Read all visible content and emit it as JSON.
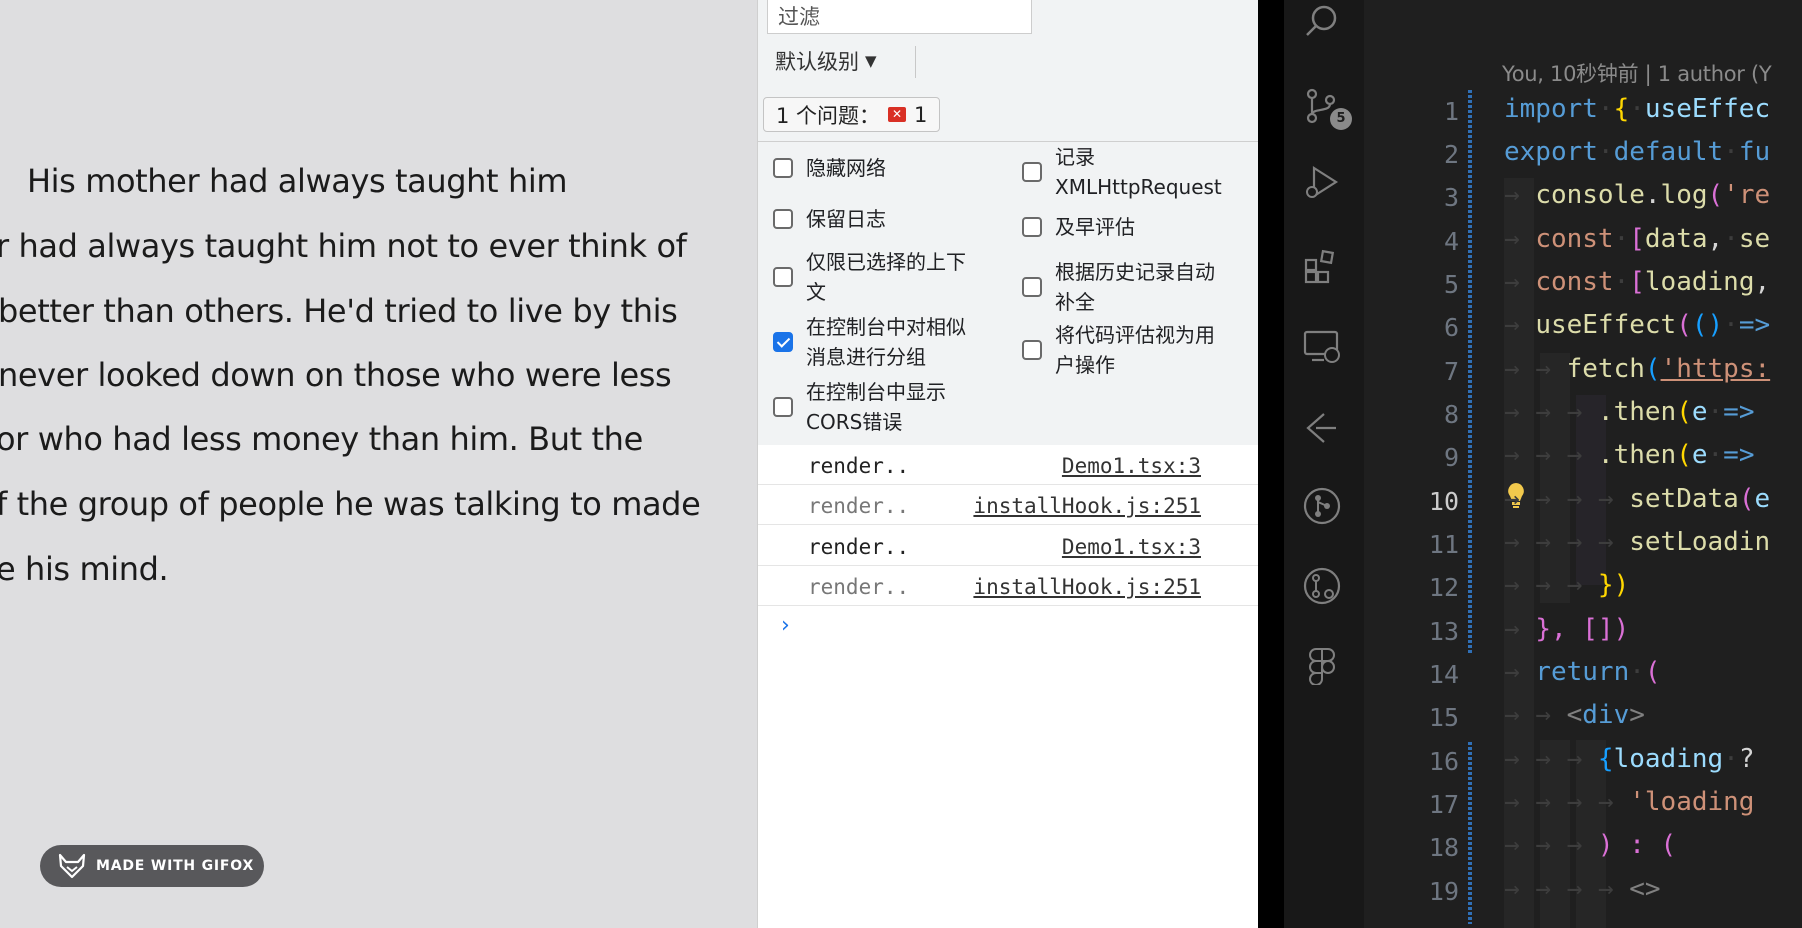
{
  "story": {
    "lines": [
      "His mother had always taught him",
      "r had always taught him not to ever think of",
      "better than others. He'd tried to live by this",
      "never looked down on those who were less",
      "or who had less money than him. But the",
      "f the group of people he was talking to made",
      "e his mind."
    ]
  },
  "gifox": {
    "label": "MADE WITH GIFOX"
  },
  "devtools": {
    "filter_placeholder": "过滤",
    "level_label": "默认级别",
    "issues_label": "1 个问题：",
    "issues_count": "1",
    "settings": [
      {
        "label": "隐藏网络",
        "checked": false
      },
      {
        "label": "记录 XMLHttpRequest",
        "checked": false
      },
      {
        "label": "保留日志",
        "checked": false
      },
      {
        "label": "及早评估",
        "checked": false
      },
      {
        "label": "仅限已选择的上下文",
        "checked": false
      },
      {
        "label": "根据历史记录自动补全",
        "checked": false
      },
      {
        "label": "在控制台中对相似消息进行分组",
        "checked": true
      },
      {
        "label": "将代码评估视为用户操作",
        "checked": false
      },
      {
        "label": "在控制台中显示 CORS错误",
        "checked": false
      }
    ],
    "logs": [
      {
        "message": "render..",
        "source": "Demo1.tsx:3"
      },
      {
        "message": "render..",
        "source": "installHook.js:251"
      },
      {
        "message": "render..",
        "source": "Demo1.tsx:3"
      },
      {
        "message": "render..",
        "source": "installHook.js:251"
      }
    ],
    "prompt_symbol": "›"
  },
  "vscode": {
    "scm_badge": "5",
    "codelens": "You, 10秒钟前 | 1 author (Y",
    "active_line": 10,
    "line_numbers": [
      "1",
      "2",
      "3",
      "4",
      "5",
      "6",
      "7",
      "8",
      "9",
      "10",
      "11",
      "12",
      "13",
      "14",
      "15",
      "16",
      "17",
      "18",
      "19"
    ],
    "code": {
      "l1_kw": "import",
      "l1_br": "{",
      "l1_fn": "useEffec",
      "l2_kw": "export",
      "l2_kw2": "default",
      "l2_fn": "fu",
      "l3_obj": "console",
      "l3_fn": "log",
      "l3_str": "'re",
      "l4_kw": "const",
      "l4_var1": "data",
      "l4_var2": "se",
      "l5_kw": "const",
      "l5_var1": "loading",
      "l6_fn": "useEffect",
      "l6_arrow": "=>",
      "l7_fn": "fetch",
      "l7_str": "'https:",
      "l8_fn": ".then",
      "l8_var": "e",
      "l8_arrow": "=>",
      "l9_fn": ".then",
      "l9_var": "e",
      "l9_arrow": "=>",
      "l10_fn": "setData",
      "l10_var": "e",
      "l11_fn": "setLoadin",
      "l12_br": "})",
      "l13_text": "}, [])",
      "l14_kw": "return",
      "l14_br": "(",
      "l15_tag": "div",
      "l16_var": "loading",
      "l16_op": "?",
      "l17_str": "'loading",
      "l18_text": ") : (",
      "l19_text": "<>"
    }
  }
}
